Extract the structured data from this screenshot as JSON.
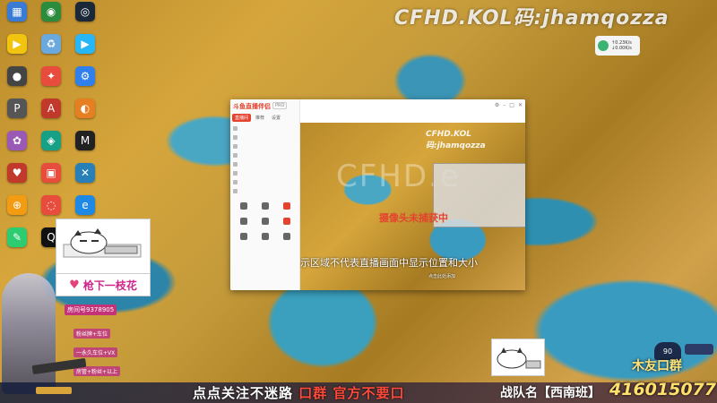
{
  "desktop": {
    "watermark": "CFHD.KOL码:jhamqozza",
    "icons": [
      {
        "label": "",
        "glyph": "▦",
        "color": "#3a7bd5"
      },
      {
        "label": "",
        "glyph": "◉",
        "color": "#2b8c3e"
      },
      {
        "label": "",
        "glyph": "◎",
        "color": "#1b2838"
      },
      {
        "label": "",
        "glyph": "▶",
        "color": "#f1c40f"
      },
      {
        "label": "",
        "glyph": "♻",
        "color": "#6aa9dd"
      },
      {
        "label": "",
        "glyph": "▶",
        "color": "#29b6f6"
      },
      {
        "label": "",
        "glyph": "●",
        "color": "#444"
      },
      {
        "label": "",
        "glyph": "✦",
        "color": "#e74c3c"
      },
      {
        "label": "",
        "glyph": "⚙",
        "color": "#2f80ed"
      },
      {
        "label": "",
        "glyph": "P",
        "color": "#555"
      },
      {
        "label": "",
        "glyph": "A",
        "color": "#c0392b"
      },
      {
        "label": "",
        "glyph": "◐",
        "color": "#e67e22"
      },
      {
        "label": "",
        "glyph": "✿",
        "color": "#9b59b6"
      },
      {
        "label": "",
        "glyph": "◈",
        "color": "#16a085"
      },
      {
        "label": "",
        "glyph": "M",
        "color": "#222"
      },
      {
        "label": "",
        "glyph": "♥",
        "color": "#c0392b"
      },
      {
        "label": "",
        "glyph": "▣",
        "color": "#e74c3c"
      },
      {
        "label": "",
        "glyph": "✕",
        "color": "#2980b9"
      },
      {
        "label": "",
        "glyph": "⊕",
        "color": "#f39c12"
      },
      {
        "label": "",
        "glyph": "◌",
        "color": "#e74c3c"
      },
      {
        "label": "",
        "glyph": "e",
        "color": "#1e88e5"
      },
      {
        "label": "",
        "glyph": "✎",
        "color": "#2ecc71"
      },
      {
        "label": "",
        "glyph": "Q",
        "color": "#111"
      },
      {
        "label": "",
        "glyph": "◐",
        "color": "#27ae60"
      }
    ]
  },
  "network_widget": {
    "line1": "↑0.23K/s",
    "line2": "↓0.00K/s"
  },
  "app_window": {
    "logo": "斗鱼直播伴侣",
    "badge": "PRO",
    "tabs": [
      "直播间",
      "推荐",
      "设置"
    ],
    "list": [
      "",
      "",
      "",
      "",
      "",
      "",
      "",
      ""
    ],
    "grid": [
      "",
      "",
      "",
      "",
      "",
      "",
      "",
      "",
      ""
    ],
    "side_footer": "",
    "toolbar_items": [
      "",
      "",
      "",
      "",
      ""
    ],
    "stream": {
      "watermark": "CFHD.KOL码:jhamqozza",
      "big_text": "CFHD.e",
      "red_text": "摄像头未捕获中",
      "note": "此提示区域不代表直播画面中显示位置和大小",
      "footer": "点击此处添加"
    }
  },
  "overlays": {
    "streamer_name": "枪下一枝花",
    "room": "房间号9378905",
    "tags": [
      "粉丝牌+车位",
      "一永久车位+VX",
      "房管+粉丝+以上"
    ],
    "ticker_white": "点点关注不迷路",
    "ticker_red": "口群 官方不要口",
    "team": "战队名【西南班】",
    "qq": "416015077",
    "brand": "木友口群",
    "gauge": "90",
    "small_line": ""
  }
}
